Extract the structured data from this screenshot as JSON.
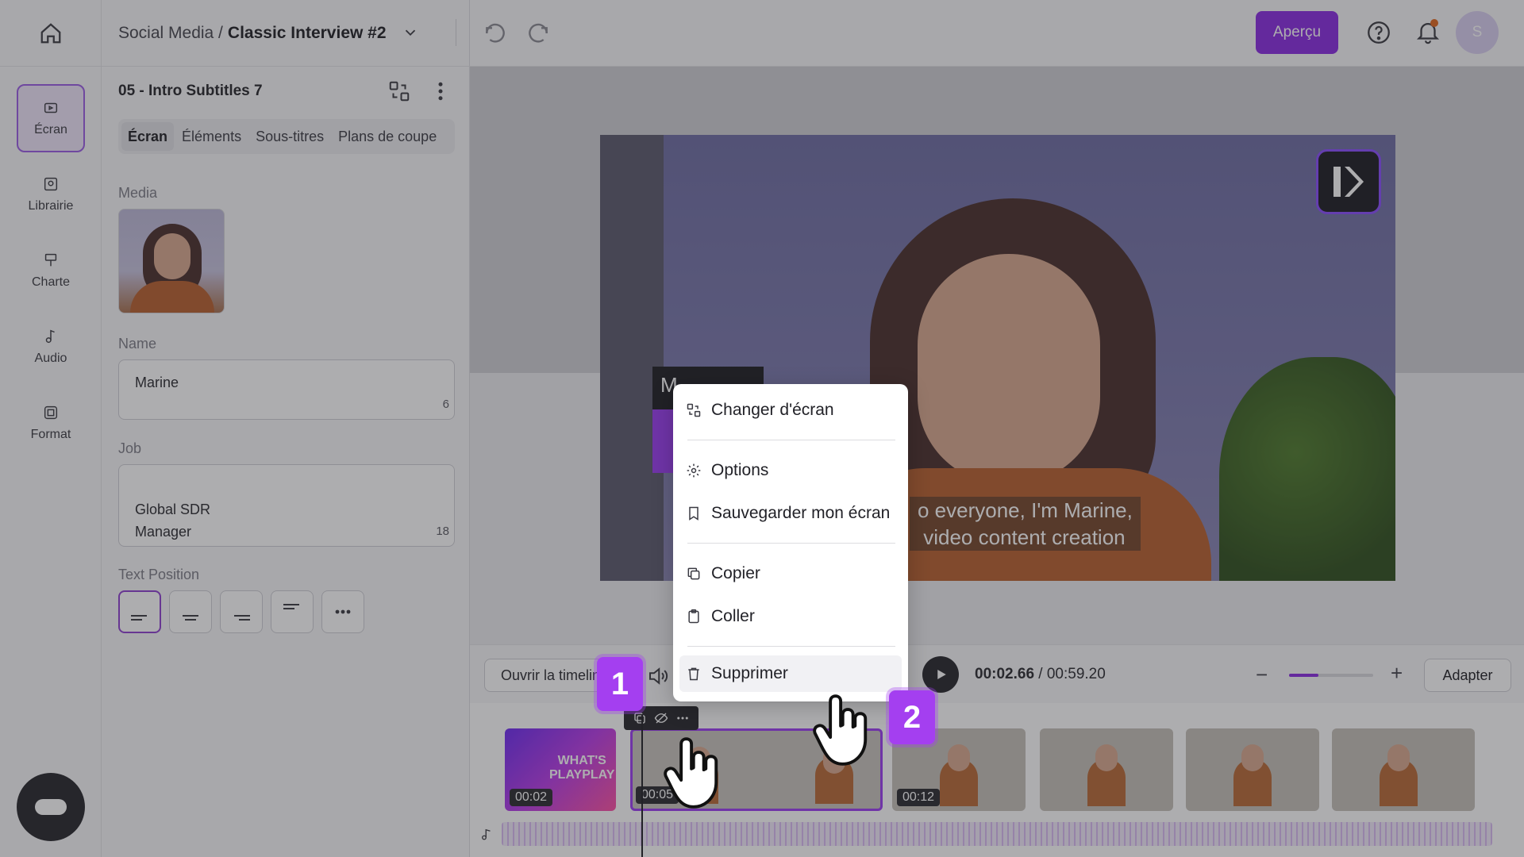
{
  "project": {
    "folder": "Social Media /",
    "name": "Classic Interview #2"
  },
  "leftnav": {
    "items": [
      {
        "label": "Écran",
        "icon": "screen-icon"
      },
      {
        "label": "Librairie",
        "icon": "library-icon"
      },
      {
        "label": "Charte",
        "icon": "brand-icon"
      },
      {
        "label": "Audio",
        "icon": "audio-icon"
      },
      {
        "label": "Format",
        "icon": "format-icon"
      }
    ]
  },
  "panel": {
    "scene_title": "05 - Intro Subtitles 7",
    "tabs": [
      "Écran",
      "Éléments",
      "Sous-titres",
      "Plans de coupe"
    ],
    "media_label": "Media",
    "name_label": "Name",
    "name_value": "Marine",
    "name_count": "6",
    "job_label": "Job",
    "job_value": "Global SDR\nManager",
    "job_count": "18",
    "text_position_label": "Text Position"
  },
  "topbar": {
    "preview_label": "Aperçu",
    "avatar_initial": "S",
    "accent": "#8a2be2"
  },
  "canvas": {
    "subtitle": "o everyone, I'm Marine,\n video content creation",
    "name_tag": "M"
  },
  "context_menu": {
    "items": [
      {
        "label": "Changer d'écran",
        "icon": "swap-screen-icon"
      },
      {
        "label": "Options",
        "icon": "gear-icon"
      },
      {
        "label": "Sauvegarder mon écran",
        "icon": "bookmark-icon"
      },
      {
        "label": "Copier",
        "icon": "copy-icon"
      },
      {
        "label": "Coller",
        "icon": "paste-icon"
      },
      {
        "label": "Supprimer",
        "icon": "trash-icon"
      }
    ]
  },
  "playback": {
    "open_timeline_label": "Ouvrir la timeline",
    "current_time": "00:02.66",
    "separator": " / ",
    "total_time": "00:59.20",
    "zoom_level": 0.35,
    "adapt_label": "Adapter"
  },
  "timeline": {
    "intro_text": "WHAT'S\nPLAYPLAY",
    "clips": [
      {
        "time": "00:02"
      },
      {
        "time": "00:05"
      },
      {
        "time": "00:12"
      }
    ]
  },
  "steps": {
    "one": "1",
    "two": "2"
  }
}
